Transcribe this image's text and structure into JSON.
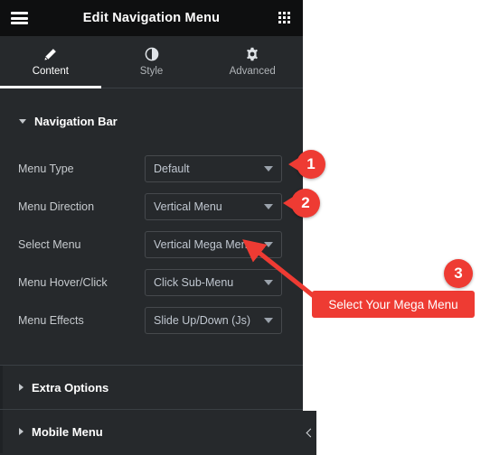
{
  "header": {
    "title": "Edit Navigation Menu",
    "menu_icon": "hamburger-icon",
    "apps_icon": "grid-apps-icon"
  },
  "tabs": [
    {
      "label": "Content",
      "icon": "pencil-icon",
      "active": true
    },
    {
      "label": "Style",
      "icon": "contrast-half-circle-icon",
      "active": false
    },
    {
      "label": "Advanced",
      "icon": "gear-icon",
      "active": false
    }
  ],
  "sections": {
    "navigation_bar": {
      "title": "Navigation Bar",
      "expanded": true
    },
    "extra_options": {
      "title": "Extra Options",
      "expanded": false
    },
    "mobile_menu": {
      "title": "Mobile Menu",
      "expanded": false
    }
  },
  "controls": [
    {
      "label": "Menu Type",
      "value": "Default"
    },
    {
      "label": "Menu Direction",
      "value": "Vertical Menu"
    },
    {
      "label": "Select Menu",
      "value": "Vertical Mega Menu"
    },
    {
      "label": "Menu Hover/Click",
      "value": "Click Sub-Menu"
    },
    {
      "label": "Menu Effects",
      "value": "Slide Up/Down (Js)"
    }
  ],
  "annotations": {
    "badge_1": "1",
    "badge_2": "2",
    "badge_3": "3",
    "callout_text": "Select Your Mega Menu",
    "accent_color": "#ee3b33"
  },
  "collapse_handle": {
    "icon": "chevron-left-icon"
  }
}
